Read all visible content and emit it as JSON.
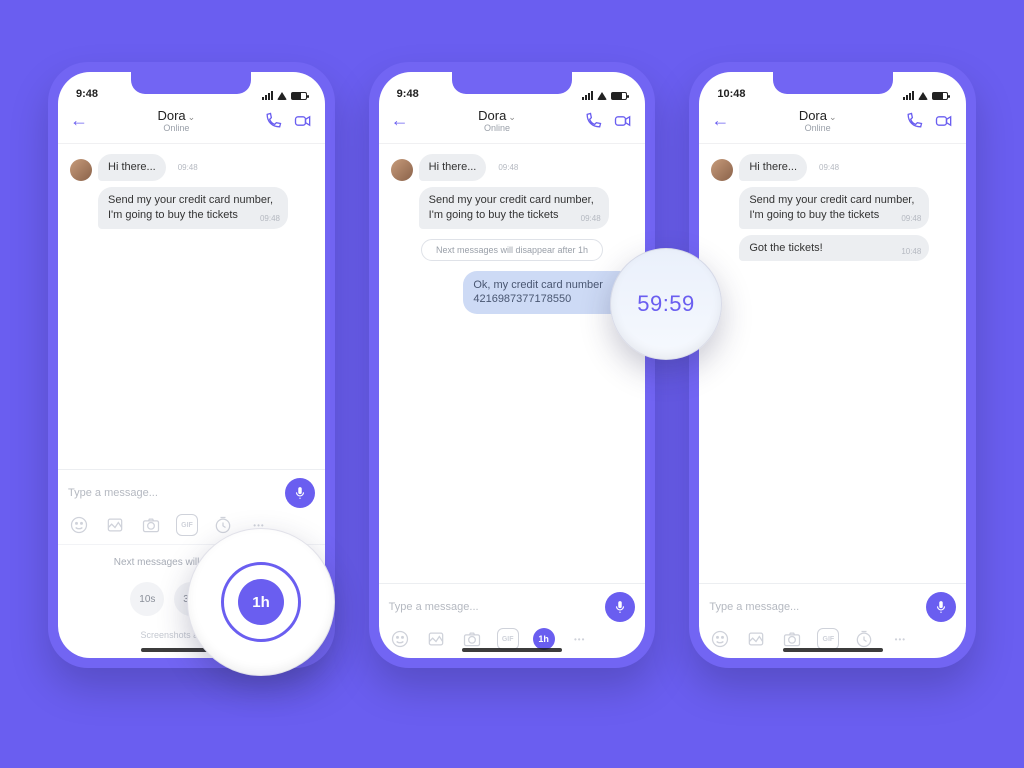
{
  "colors": {
    "accent": "#6a5ef0",
    "bg": "#6a5ef0",
    "bubble_out": "#cddaf5"
  },
  "phones": [
    {
      "status_time": "9:48",
      "header": {
        "name": "Dora",
        "status": "Online"
      },
      "messages": {
        "m1_text": "Hi there...",
        "m1_time": "09:48",
        "m2_text": "Send my your credit card number, I'm going to buy the tickets",
        "m2_time": "09:48"
      },
      "input_placeholder": "Type a message...",
      "timer_panel": {
        "caption": "Next messages will disappear after",
        "chips": [
          "10s",
          "30s"
        ],
        "screenshot_line": "Screenshots are disabled"
      },
      "magnifier": "1h"
    },
    {
      "status_time": "9:48",
      "header": {
        "name": "Dora",
        "status": "Online"
      },
      "messages": {
        "m1_text": "Hi there...",
        "m1_time": "09:48",
        "m2_text": "Send my your credit card number, I'm going to buy the tickets",
        "m2_time": "09:48",
        "divider": "Next messages will disappear after 1h",
        "out_text": "Ok, my credit card number 4216987377178550"
      },
      "input_placeholder": "Type a message...",
      "tool_badge": "1h",
      "magnifier": "59:59"
    },
    {
      "status_time": "10:48",
      "header": {
        "name": "Dora",
        "status": "Online"
      },
      "messages": {
        "m1_text": "Hi there...",
        "m1_time": "09:48",
        "m2_text": "Send my your credit card number, I'm going to buy the tickets",
        "m2_time": "09:48",
        "m3_text": "Got the tickets!",
        "m3_time": "10:48"
      },
      "input_placeholder": "Type a message..."
    }
  ]
}
